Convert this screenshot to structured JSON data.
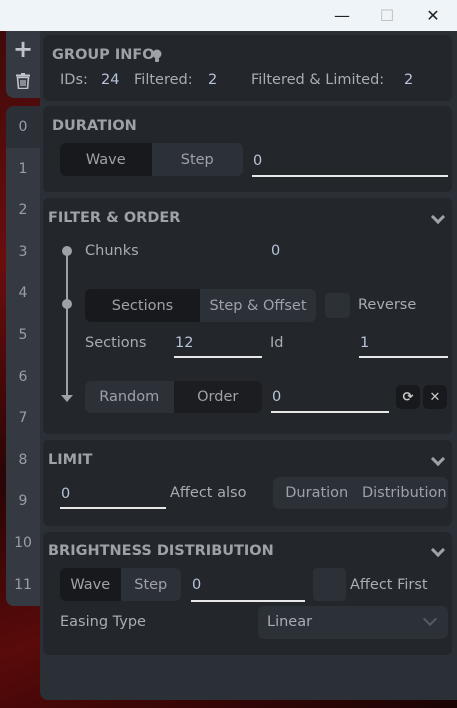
{
  "window": {
    "controls": {
      "minimize": "—",
      "maximize": "☐",
      "close": "✕"
    }
  },
  "sidebar": {
    "add_icon": "+",
    "numbers": [
      "0",
      "1",
      "2",
      "3",
      "4",
      "5",
      "6",
      "7",
      "8",
      "9",
      "10",
      "11"
    ]
  },
  "group_info": {
    "title": "GROUP INFO",
    "ids_label": "IDs:",
    "ids": "24",
    "filtered_label": "Filtered:",
    "filtered": "2",
    "fl_label": "Filtered & Limited:",
    "fl": "2"
  },
  "duration": {
    "title": "DURATION",
    "options": [
      "Wave",
      "Step"
    ],
    "selected": "Wave",
    "value": "0"
  },
  "filter_order": {
    "title": "FILTER & ORDER",
    "chunks_label": "Chunks",
    "chunks": "0",
    "mode_options": [
      "Sections",
      "Step & Offset"
    ],
    "mode_selected": "Sections",
    "reverse_label": "Reverse",
    "reverse": false,
    "sections_label": "Sections",
    "sections": "12",
    "id_label": "Id",
    "id": "1",
    "order_options": [
      "Random",
      "Order"
    ],
    "order_selected": "Order",
    "order_value": "0"
  },
  "limit": {
    "title": "LIMIT",
    "value": "0",
    "affect_label": "Affect also",
    "affect_options": [
      "Duration",
      "Distribution"
    ]
  },
  "brightness": {
    "title": "BRIGHTNESS DISTRIBUTION",
    "options": [
      "Wave",
      "Step"
    ],
    "selected": "Wave",
    "value": "0",
    "affect_first_label": "Affect First",
    "affect_first": false,
    "easing_label": "Easing Type",
    "easing": "Linear"
  }
}
